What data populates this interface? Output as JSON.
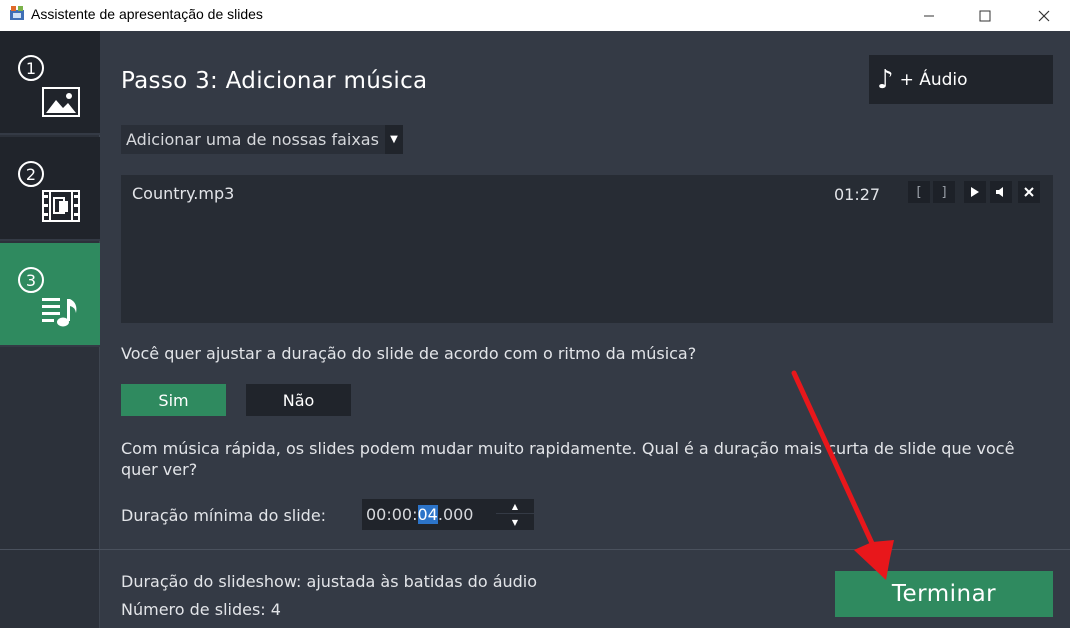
{
  "window": {
    "title": "Assistente de apresentação de slides",
    "minimize_glyph": "—",
    "maximize_glyph": "☐",
    "close_glyph": "✕"
  },
  "sidebar": {
    "steps": [
      {
        "number": "1",
        "icon": "image-icon",
        "active": false
      },
      {
        "number": "2",
        "icon": "film-icon",
        "active": false
      },
      {
        "number": "3",
        "icon": "music-list-icon",
        "active": true
      }
    ]
  },
  "main": {
    "heading": "Passo 3: Adicionar música",
    "audio_button_label": "+ Áudio",
    "audio_button_icon": "♪",
    "dropdown_value": "Adicionar uma de nossas faixas",
    "dropdown_arrow": "▼",
    "track": {
      "name": "Country.mp3",
      "duration": "01:27",
      "controls": [
        "[",
        "]",
        "▶",
        "🔈",
        "✕"
      ]
    },
    "question": "Você quer ajustar a duração do slide de acordo com o ritmo da música?",
    "yes_label": "Sim",
    "no_label": "Não",
    "info_text": "Com música rápida, os slides podem mudar muito rapidamente. Qual é a duração mais curta de slide que você quer ver?",
    "min_duration_label": "Duração mínima do slide:",
    "min_duration_prefix": "00:00:",
    "min_duration_selected": "04",
    "min_duration_suffix": ".000",
    "spin_up": "▲",
    "spin_down": "▼"
  },
  "footer": {
    "slideshow_duration": "Duração do slideshow: ajustada às batidas do áudio",
    "slide_count": "Número de slides: 4",
    "finish_label": "Terminar"
  },
  "colors": {
    "accent_green": "#2f8a5f",
    "background": "#343a45",
    "annotation_arrow": "#e8171b"
  }
}
